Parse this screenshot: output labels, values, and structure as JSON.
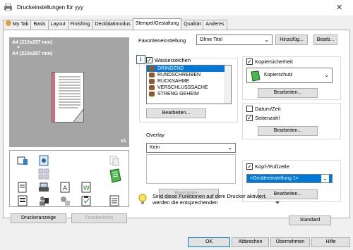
{
  "window": {
    "title": "Druckeinstellungen für yyy",
    "close": "✕"
  },
  "tabs": [
    "My Tab",
    "Basis",
    "Layout",
    "Finishing",
    "Deckblattmodus",
    "Stempel/Gestaltung",
    "Qualität",
    "Anderes"
  ],
  "active_tab": "Stempel/Gestaltung",
  "favorites": {
    "label": "Favoriteneinstellung",
    "value": "Ohne Titel",
    "add_button": "Hinzufüg...",
    "edit_button": "Bearb..."
  },
  "preview": {
    "paper_line1": "A4 (210x297 mm)",
    "arrow": "▼",
    "paper_line2": "A4 (210x297 mm)",
    "count": "x1"
  },
  "left_buttons": {
    "printer_display": "Druckeranzeige",
    "printer_info": "Druckerinfos"
  },
  "watermark": {
    "label": "Wasserzeichen",
    "checked": true,
    "items": [
      "DRINGEND",
      "RUNDSCHREIBEN",
      "RÜCKNAHME",
      "VERSCHLUSSSACHE",
      "STRENG GEHEIM"
    ],
    "selected_index": 0,
    "edit_button": "Bearbeiten..."
  },
  "overlay": {
    "label": "Overlay",
    "value": "Kein",
    "edit_button": "Bearbeiten..."
  },
  "copy_security": {
    "label": "Kopiersicherheit",
    "checked": true,
    "value": "Kopierschutz",
    "edit_button": "Bearbeiten..."
  },
  "date_time": {
    "label": "Datum/Zeit",
    "checked": false
  },
  "page_number": {
    "label": "Seitenzahl",
    "checked": true,
    "edit_button": "Bearbeiten..."
  },
  "header_footer": {
    "label": "Kopf-/Fußzeile",
    "checked": true,
    "value": "<Geräteeinstellung 1>",
    "edit_button": "Bearbeiten..."
  },
  "info_note": {
    "text_line1": "Sind diese Funktionen auf dem Drucker aktiviert,",
    "text_line2": "werden die entsprechenden"
  },
  "standard_button": "Standard",
  "footer_buttons": {
    "ok": "OK",
    "cancel": "Abbrechen",
    "apply": "Übernehmen",
    "help": "Hilfe"
  },
  "colors": {
    "selection": "#0078d7",
    "preview_bg": "#a5a5a5",
    "tab_border": "#adadad"
  }
}
